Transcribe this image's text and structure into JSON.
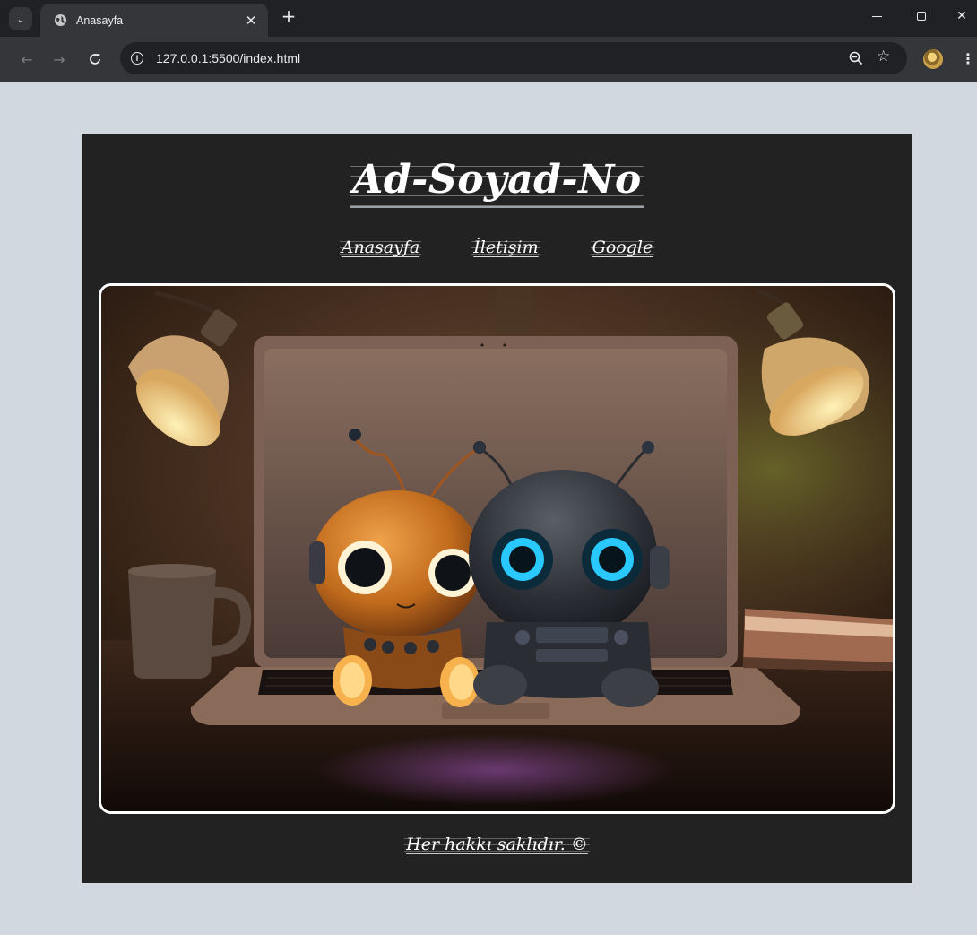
{
  "browser": {
    "tab": {
      "title": "Anasayfa",
      "favicon": "globe-icon"
    },
    "url": "127.0.0.1:5500/index.html"
  },
  "page": {
    "title": "Ad-Soyad-No",
    "nav": [
      {
        "label": "Anasayfa"
      },
      {
        "label": "İletişim"
      },
      {
        "label": "Google"
      }
    ],
    "hero_image": {
      "alt": "two-robots-on-laptop-illustration"
    },
    "footer": "Her hakkı saklıdır. ©"
  },
  "colors": {
    "page_background": "#d1d8e0",
    "card_background": "#222222",
    "text": "#ffffff",
    "browser_frame": "#202124",
    "browser_toolbar": "#35363a"
  }
}
